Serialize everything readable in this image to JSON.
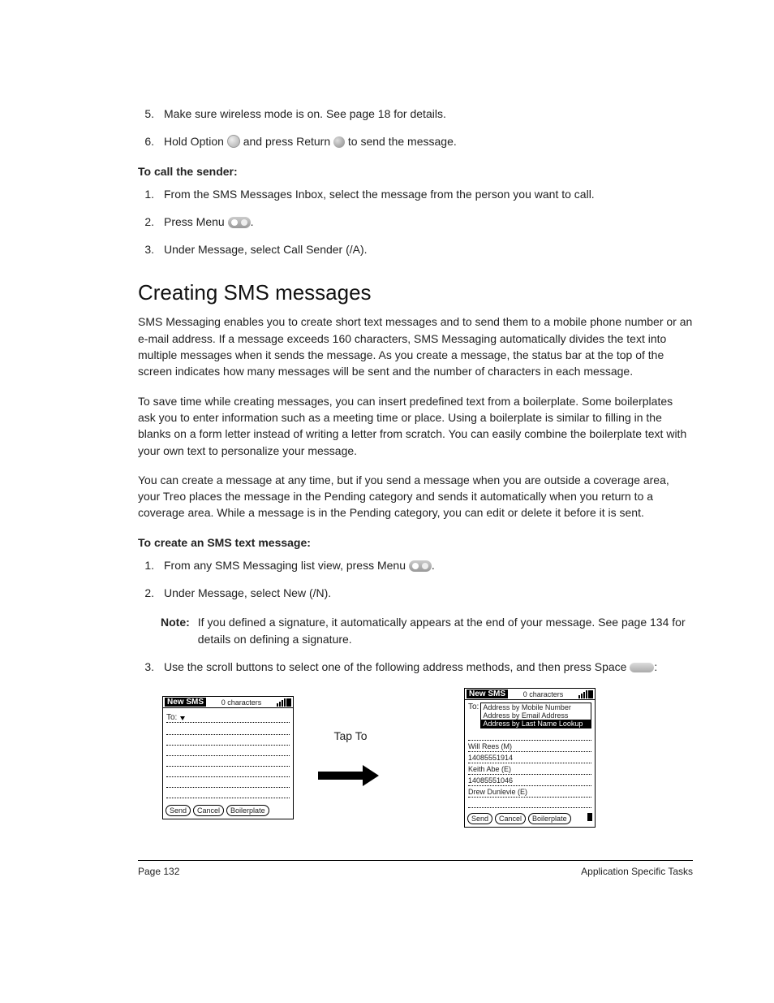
{
  "steps_a": [
    {
      "n": "5.",
      "text": "Make sure wireless mode is on. See page 18 for details."
    },
    {
      "n": "6.",
      "pre": "Hold Option ",
      "mid": " and press Return ",
      "post": " to send the message."
    }
  ],
  "call_sender": {
    "heading": "To call the sender:",
    "items": [
      {
        "n": "1.",
        "text": "From the SMS Messages Inbox, select the message from the person you want to call."
      },
      {
        "n": "2.",
        "pre": "Press Menu ",
        "post": "."
      },
      {
        "n": "3.",
        "text": "Under Message, select Call Sender (/A)."
      }
    ]
  },
  "section": {
    "title": "Creating SMS messages",
    "p1": "SMS Messaging enables you to create short text messages and to send them to a mobile phone number or an e-mail address. If a message exceeds 160 characters, SMS Messaging automatically divides the text into multiple messages when it sends the message. As you create a message, the status bar at the top of the screen indicates how many messages will be sent and the number of characters in each message.",
    "p2": "To save time while creating messages, you can insert predefined text from a boilerplate. Some boilerplates ask you to enter information such as a meeting time or place. Using a boilerplate is similar to filling in the blanks on a form letter instead of writing a letter from scratch. You can easily combine the boilerplate text with your own text to personalize your message.",
    "p3": "You can create a message at any time, but if you send a message when you are outside a coverage area, your Treo places the message in the Pending category and sends it automatically when you return to a coverage area. While a message is in the Pending category, you can edit or delete it before it is sent."
  },
  "create": {
    "heading": "To create an SMS text message:",
    "items": [
      {
        "n": "1.",
        "pre": "From any SMS Messaging list view, press Menu ",
        "post": "."
      },
      {
        "n": "2.",
        "text": "Under Message, select New (/N)."
      }
    ],
    "note_label": "Note:",
    "note_text": "If you defined a signature, it automatically appears at the end of your message. See page 134 for details on defining a signature.",
    "item3": {
      "n": "3.",
      "pre": "Use the scroll buttons to select one of the following address methods, and then press Space ",
      "post": ":"
    }
  },
  "mock": {
    "title": "New SMS",
    "chars": "0 characters",
    "to": "To:",
    "send": "Send",
    "cancel": "Cancel",
    "boiler": "Boilerplate",
    "tapto": "Tap To",
    "popup": {
      "opt1": "Address by Mobile Number",
      "opt2": "Address by Email Address",
      "opt3": "Address by Last Name Lookup"
    },
    "contacts": [
      "Will Rees (M)",
      "14085551914",
      "Keith Abe (E)",
      "14085551046",
      "Drew Dunlevie (E)"
    ]
  },
  "footer": {
    "left": "Page 132",
    "right": "Application Specific Tasks"
  }
}
